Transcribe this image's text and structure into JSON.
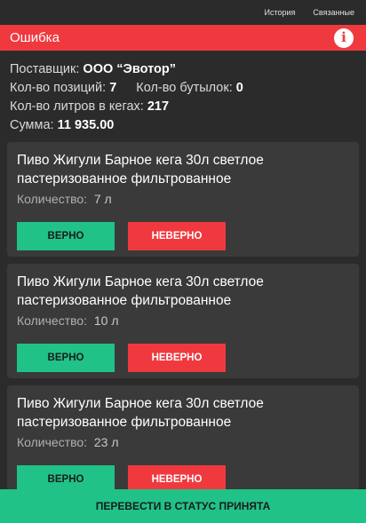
{
  "topbar": {
    "history": "История",
    "related": "Связанные"
  },
  "error": {
    "title": "Ошибка",
    "icon": "info-icon"
  },
  "summary": {
    "supplier_label": "Поставщик: ",
    "supplier_value": "ООО “Эвотор”",
    "positions_label": "Кол-во позиций: ",
    "positions_value": "7",
    "bottles_label": "Кол-во бутылок: ",
    "bottles_value": "0",
    "liters_label": "Кол-во литров в кегах: ",
    "liters_value": "217",
    "sum_label": "Сумма: ",
    "sum_value": "11 935.00"
  },
  "items": [
    {
      "name": "Пиво Жигули Барное кега 30л светлое пастеризованное фильтрованное",
      "qty_label": "Количество: ",
      "qty_value": "7 л",
      "ok": "ВЕРНО",
      "bad": "НЕВЕРНО"
    },
    {
      "name": "Пиво Жигули Барное кега 30л светлое пастеризованное фильтрованное",
      "qty_label": "Количество: ",
      "qty_value": "10 л",
      "ok": "ВЕРНО",
      "bad": "НЕВЕРНО"
    },
    {
      "name": "Пиво Жигули Барное кега 30л светлое пастеризованное фильтрованное",
      "qty_label": "Количество: ",
      "qty_value": "23 л",
      "ok": "ВЕРНО",
      "bad": "НЕВЕРНО"
    }
  ],
  "bottom_button": "ПЕРЕВЕСТИ В СТАТУС ПРИНЯТА",
  "colors": {
    "error": "#f0393f",
    "accept": "#20c287",
    "background": "#2b2b2b",
    "card": "#3a3a3a"
  }
}
